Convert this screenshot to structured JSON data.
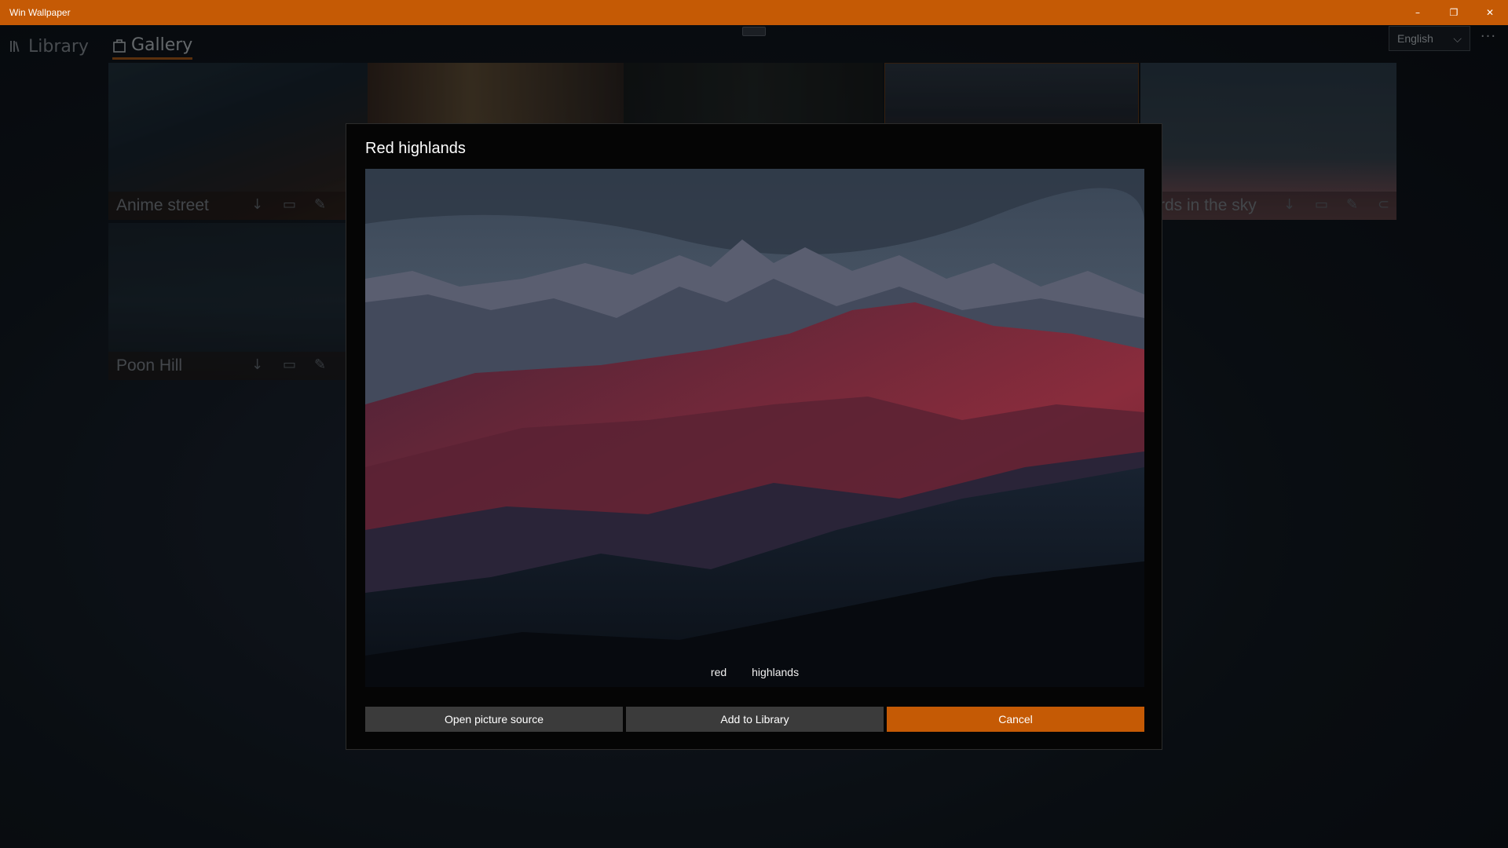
{
  "window": {
    "title": "Win Wallpaper",
    "minimize": "–",
    "restore": "❐",
    "close": "✕"
  },
  "nav": {
    "items": [
      {
        "label": "Library",
        "icon": "library-icon"
      },
      {
        "label": "Gallery",
        "icon": "gallery-icon",
        "active": true
      }
    ]
  },
  "language": {
    "selected": "English",
    "chevron": "⌵"
  },
  "more": "···",
  "gallery": {
    "cards": [
      {
        "title": "Anime street"
      },
      {
        "title": "Poon Hill"
      },
      {
        "title": "rds in the sky"
      }
    ],
    "card_icons": [
      "↓",
      "▭",
      "✎",
      "⊂"
    ]
  },
  "dialog": {
    "title": "Red highlands",
    "tags": [
      "red",
      "highlands"
    ],
    "buttons": {
      "open_source": "Open picture source",
      "add_library": "Add to Library",
      "cancel": "Cancel"
    }
  },
  "colors": {
    "accent": "#c55a05",
    "button": "#3b3b3b",
    "dialog_bg": "#050505"
  }
}
